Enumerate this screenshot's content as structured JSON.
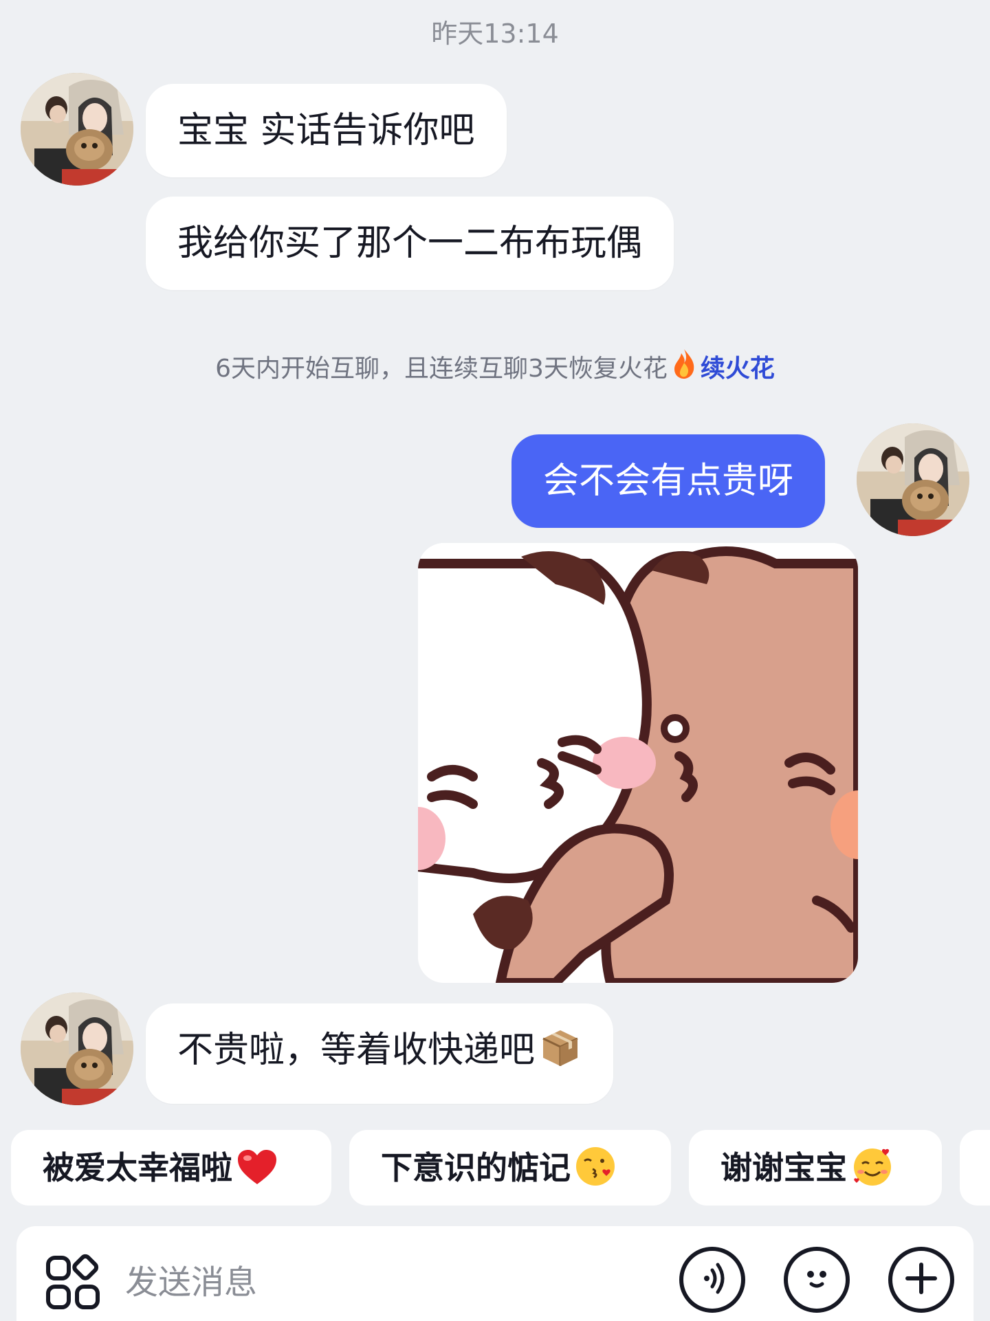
{
  "chat": {
    "timestamp": "昨天13:14",
    "messages_before": [
      {
        "text": "宝宝 实话告诉你吧"
      },
      {
        "text": "我给你买了那个一二布布玩偶"
      }
    ],
    "notice": {
      "text": "6天内开始互聊，且连续互聊3天恢复火花",
      "link": "续火花",
      "icon": "flame-icon"
    },
    "my_message": {
      "text": "会不会有点贵呀"
    },
    "sticker": {
      "icon": "kissing-bears-sticker"
    },
    "reply": {
      "text": "不贵啦，等着收快递吧",
      "icon": "package-icon"
    }
  },
  "quick_replies": [
    {
      "label": "被爱太幸福啦",
      "icon": "red-heart-icon"
    },
    {
      "label": "下意识的惦记",
      "icon": "kissing-face-icon"
    },
    {
      "label": "谢谢宝宝",
      "icon": "smiling-face-with-hearts-icon"
    }
  ],
  "input_bar": {
    "placeholder": "发送消息",
    "buttons": [
      "apps-icon",
      "voice-icon",
      "emoji-icon",
      "plus-icon"
    ]
  },
  "colors": {
    "background": "#eef0f3",
    "my_bubble": "#4a65f5",
    "link": "#2f4bd6"
  }
}
